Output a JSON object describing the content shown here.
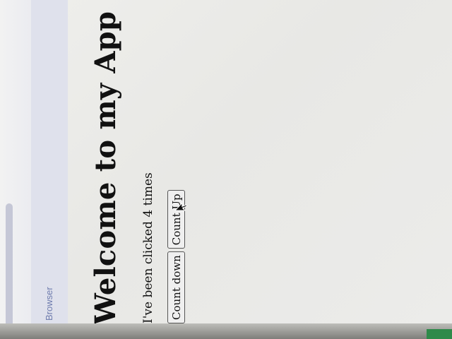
{
  "browser": {
    "tab_label": "Browser"
  },
  "app": {
    "title": "Welcome to my App",
    "click_text": "I've been clicked 4 times",
    "buttons": {
      "count_down": "Count down",
      "count_up": "Count Up"
    }
  },
  "icons": {
    "cursor": "mouse-pointer-icon"
  },
  "colors": {
    "tab_label": "#6f7cae",
    "title": "#111111",
    "button_bg": "#efefef"
  }
}
